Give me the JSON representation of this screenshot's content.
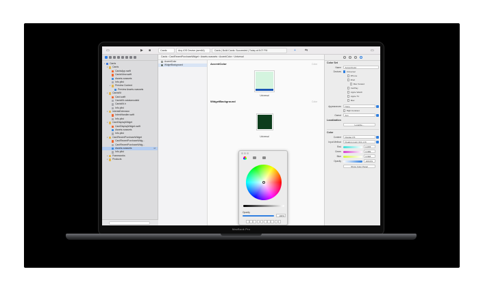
{
  "device": {
    "chin_label": "MacBook Pro"
  },
  "toolbar": {
    "scheme": "Cards",
    "destination": "Any iOS Device (arm64)",
    "status": "Cards | Build Cards: Succeeded | Today at 8:07 PM",
    "run_icon": "play-icon",
    "stop_icon": "stop-icon"
  },
  "navigator": {
    "items": [
      {
        "label": "Cards",
        "kind": "proj",
        "depth": 0
      },
      {
        "label": "Cards",
        "kind": "folder",
        "depth": 1
      },
      {
        "label": "CardsApp.swift",
        "kind": "swift",
        "depth": 2
      },
      {
        "label": "CardsView.swift",
        "kind": "swift",
        "depth": 2
      },
      {
        "label": "Assets.xcassets",
        "kind": "assets",
        "depth": 2
      },
      {
        "label": "Info.plist",
        "kind": "file",
        "depth": 2
      },
      {
        "label": "Preview Content",
        "kind": "folder",
        "depth": 2
      },
      {
        "label": "Preview Assets.xcassets",
        "kind": "assets",
        "depth": 3
      },
      {
        "label": "CardsKit",
        "kind": "folder",
        "depth": 1
      },
      {
        "label": "Card.swift",
        "kind": "swift",
        "depth": 2
      },
      {
        "label": "CardsKit.xcdatamodeld",
        "kind": "file",
        "depth": 2
      },
      {
        "label": "CardsKit.h",
        "kind": "file",
        "depth": 2
      },
      {
        "label": "Info.plist",
        "kind": "file",
        "depth": 2
      },
      {
        "label": "IntentsExtension",
        "kind": "folder",
        "depth": 1
      },
      {
        "label": "IntentHandler.swift",
        "kind": "swift",
        "depth": 2
      },
      {
        "label": "Info.plist",
        "kind": "file",
        "depth": 2
      },
      {
        "label": "CardDisplayWidget",
        "kind": "folder",
        "depth": 1
      },
      {
        "label": "CardDisplayWidget.swift",
        "kind": "swift",
        "depth": 2
      },
      {
        "label": "Assets.xcassets",
        "kind": "assets",
        "depth": 2
      },
      {
        "label": "Info.plist",
        "kind": "file",
        "depth": 2
      },
      {
        "label": "CardRecentPurchaseWidget",
        "kind": "folder",
        "depth": 1
      },
      {
        "label": "CardRecentPurchaseWidg...",
        "kind": "swift",
        "depth": 2
      },
      {
        "label": "CardRecentPurchaseWidg...",
        "kind": "file",
        "depth": 2
      },
      {
        "label": "Assets.xcassets",
        "kind": "assets",
        "depth": 2,
        "selected": true,
        "badge": "M"
      },
      {
        "label": "Info.plist",
        "kind": "file",
        "depth": 2
      },
      {
        "label": "Frameworks",
        "kind": "folder",
        "depth": 1
      },
      {
        "label": "Products",
        "kind": "folder",
        "depth": 1
      }
    ]
  },
  "jumpbar": {
    "path": "Cards  ›  CardRecentPurchaseWidget  ›  Assets.xcassets  ›  AccentColor  ›  Universal"
  },
  "set_list": [
    {
      "label": "AccentColor",
      "color": "#d9f5e4"
    },
    {
      "label": "WidgetBackground",
      "color": "#0f4f25",
      "selected": true
    }
  ],
  "editor": {
    "accent": {
      "title": "AccentColor",
      "hint": "Color",
      "caption": "Universal",
      "color": "#d4f4df",
      "bar": "#1a56b5"
    },
    "widget": {
      "title": "WidgetBackground",
      "hint": "Color",
      "caption": "Universal",
      "color": "#0d3d1c"
    }
  },
  "picker": {
    "opacity_label": "Opacity",
    "opacity_value": "100%",
    "opacity": 1.0
  },
  "inspector": {
    "color_set_header": "Color Set",
    "name_label": "Name",
    "name_value": "AccentColor",
    "devices_label": "Devices",
    "devices": [
      {
        "label": "Universal",
        "checked": true
      },
      {
        "label": "iPhone",
        "checked": false
      },
      {
        "label": "iPad",
        "checked": false
      },
      {
        "label": "Mac Scaled",
        "checked": false
      },
      {
        "label": "CarPlay",
        "checked": false
      },
      {
        "label": "Apple Watch",
        "checked": false
      },
      {
        "label": "Apple TV",
        "checked": false
      },
      {
        "label": "Mac",
        "checked": false
      }
    ],
    "appearances_label": "Appearances",
    "appearances_value": "None",
    "high_contrast": "High Contrast",
    "gamut_label": "Gamut",
    "gamut_value": "Any",
    "localization_header": "Localization",
    "localize_button": "Localize...",
    "color_header": "Color",
    "content_label": "Content",
    "content_value": "Display P3",
    "input_label": "Input Method",
    "input_value": "Floating point (0.0-1.0)",
    "red_label": "Red",
    "red_value": "0.878",
    "green_label": "Green",
    "green_value": "0.969",
    "blue_label": "Blue",
    "blue_value": "0.918",
    "opacity_label": "Opacity",
    "opacity_value": "100.0%",
    "show_panel_button": "Show Color Panel"
  }
}
